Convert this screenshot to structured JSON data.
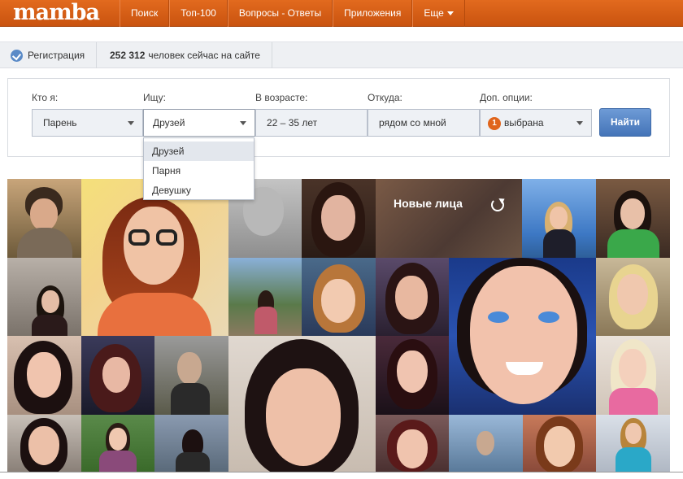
{
  "header": {
    "logo": "mamba",
    "nav": [
      "Поиск",
      "Топ-100",
      "Вопросы - Ответы",
      "Приложения",
      "Еще"
    ]
  },
  "infobar": {
    "register": "Регистрация",
    "online_count": "252 312",
    "online_text": "человек сейчас на сайте"
  },
  "search": {
    "who_label": "Кто я:",
    "who_value": "Парень",
    "seek_label": "Ищу:",
    "seek_value": "Друзей",
    "age_label": "В возрасте:",
    "age_value": "22 – 35  лет",
    "from_label": "Откуда:",
    "from_value": "рядом со мной",
    "options_label": "Доп. опции:",
    "options_count": "1",
    "options_value": "выбрана",
    "find_button": "Найти"
  },
  "dropdown": {
    "options": [
      "Друзей",
      "Парня",
      "Девушку"
    ],
    "selected": "Друзей"
  },
  "grid": {
    "new_faces_label": "Новые лица"
  }
}
